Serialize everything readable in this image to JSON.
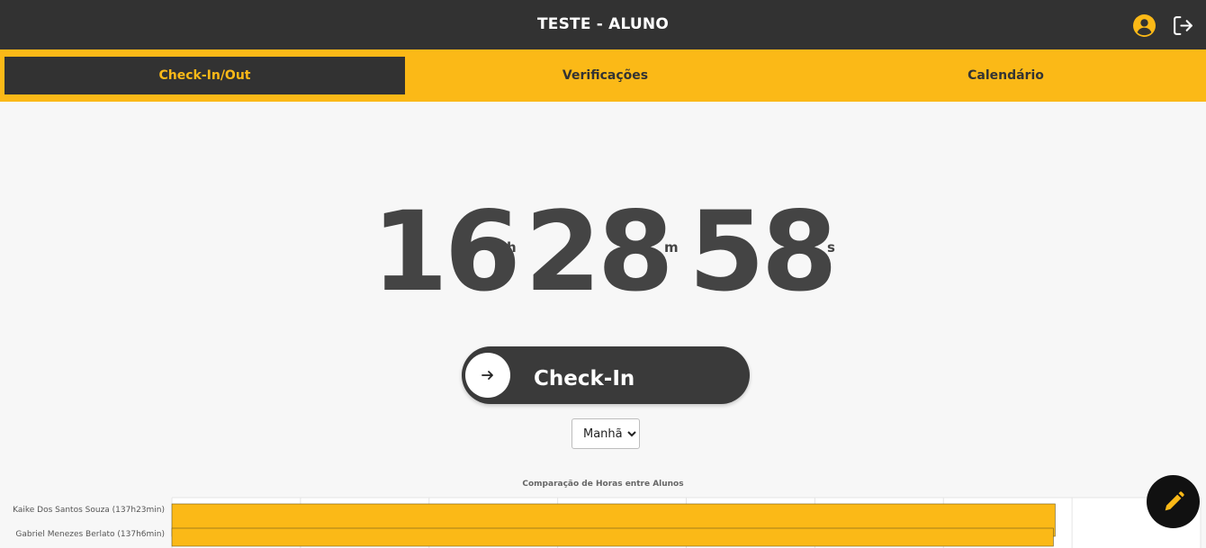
{
  "header": {
    "title": "TESTE - ALUNO",
    "user_icon": "user-circle-icon",
    "logout_icon": "logout-icon"
  },
  "tabs": [
    {
      "label": "Check-In/Out",
      "active": true
    },
    {
      "label": "Verificações",
      "active": false
    },
    {
      "label": "Calendário",
      "active": false
    }
  ],
  "clock": {
    "hours": "16",
    "hours_unit": "h",
    "minutes": "28",
    "minutes_unit": "m",
    "seconds": "58",
    "seconds_unit": "s"
  },
  "checkin": {
    "label": "Check-In",
    "icon": "arrow-right-icon"
  },
  "period": {
    "selected": "Manhã"
  },
  "colors": {
    "accent": "#fbb917",
    "dark": "#323232"
  },
  "chart_data": {
    "type": "bar",
    "orientation": "horizontal",
    "title": "Comparação de Horas entre Alunos",
    "categories": [
      "Kaike Dos Santos Souza (137h23min)",
      "Gabriel Menezes Berlato (137h6min)"
    ],
    "values": [
      137.38,
      137.1
    ],
    "value_unit": "hours",
    "xlim": [
      0,
      160
    ],
    "grid": true,
    "color": "#fbb917"
  },
  "fab": {
    "icon": "pencil-icon"
  }
}
